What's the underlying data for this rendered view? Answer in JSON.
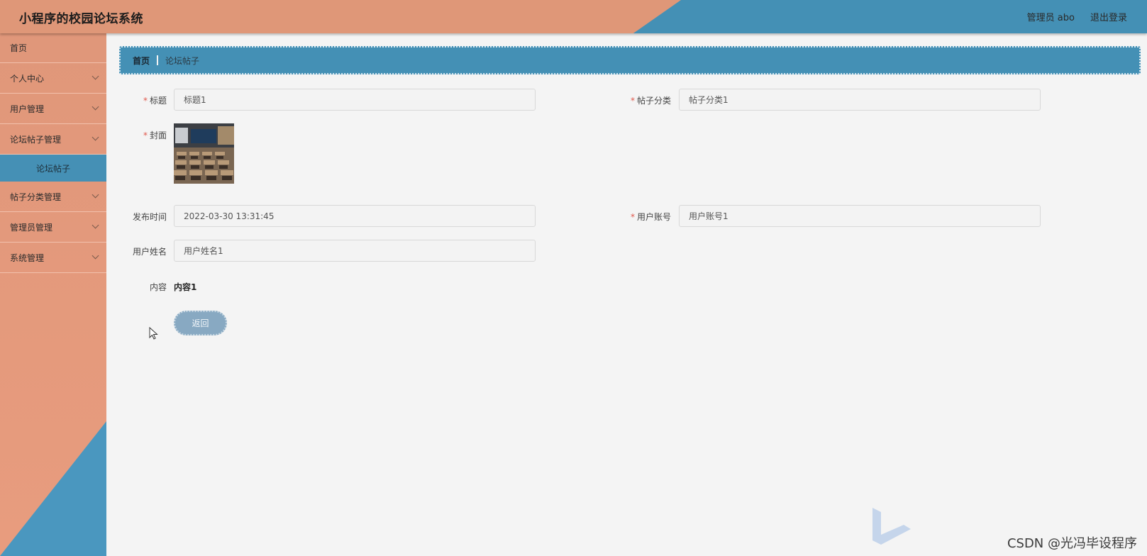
{
  "header": {
    "title": "小程序的校园论坛系统",
    "user_label": "管理员 abo",
    "logout_label": "退出登录"
  },
  "sidebar": {
    "items": [
      {
        "label": "首页"
      },
      {
        "label": "个人中心"
      },
      {
        "label": "用户管理"
      },
      {
        "label": "论坛帖子管理"
      },
      {
        "label": "论坛帖子"
      },
      {
        "label": "帖子分类管理"
      },
      {
        "label": "管理员管理"
      },
      {
        "label": "系统管理"
      }
    ]
  },
  "breadcrumb": {
    "home": "首页",
    "current": "论坛帖子"
  },
  "form": {
    "title_label": "标题",
    "title_value": "标题1",
    "category_label": "帖子分类",
    "category_value": "帖子分类1",
    "cover_label": "封面",
    "publish_time_label": "发布时间",
    "publish_time_value": "2022-03-30 13:31:45",
    "account_label": "用户账号",
    "account_value": "用户账号1",
    "username_label": "用户姓名",
    "username_value": "用户姓名1",
    "content_label": "内容",
    "content_value": "内容1",
    "required_mark": "*",
    "back_label": "返回"
  },
  "watermark": "CSDN @光冯毕设程序",
  "colors": {
    "accent_blue": "#4490b5",
    "accent_salmon": "#df9778",
    "button": "#88a9c2"
  }
}
